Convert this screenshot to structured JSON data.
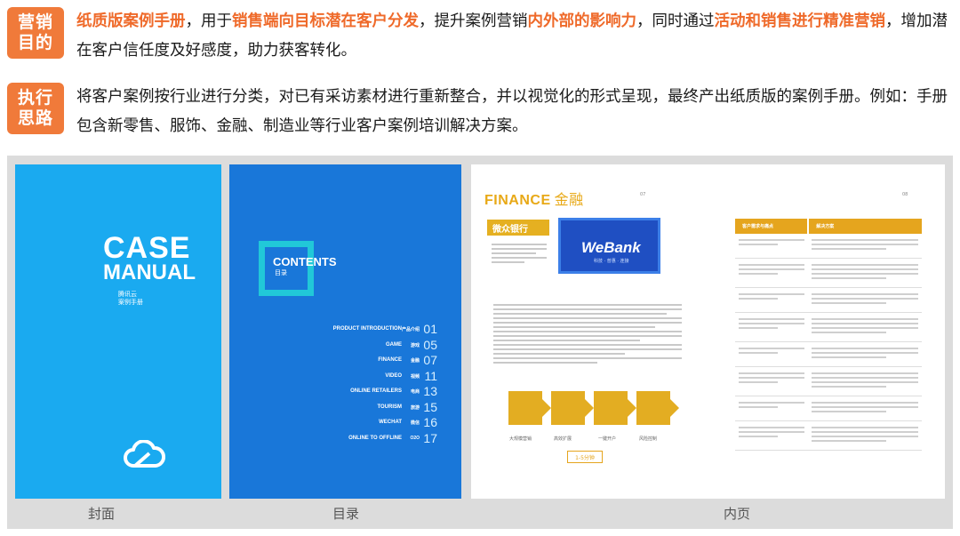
{
  "purpose": {
    "tag": "营销\n目的",
    "segments": [
      {
        "text": "纸质版案例手册",
        "hl": true
      },
      {
        "text": "，用于",
        "hl": false
      },
      {
        "text": "销售端向目标潜在客户分发",
        "hl": true
      },
      {
        "text": "，提升案例营销",
        "hl": false
      },
      {
        "text": "内外部的影响力",
        "hl": true
      },
      {
        "text": "，同时通过",
        "hl": false
      },
      {
        "text": "活动和销售进行精准营销",
        "hl": true
      },
      {
        "text": "，增加潜在客户信任度及好感度，助力获客转化。",
        "hl": false
      }
    ]
  },
  "approach": {
    "tag": "执行\n思路",
    "text": "将客户案例按行业进行分类，对已有采访素材进行重新整合，并以视觉化的形式呈现，最终产出纸质版的案例手册。例如：手册包含新零售、服饰、金融、制造业等行业客户案例培训解决方案。"
  },
  "cover": {
    "title_line1": "CASE",
    "title_line2": "MANUAL",
    "brand": "腾讯云",
    "subtitle": "案例手册",
    "caption": "封面"
  },
  "contents": {
    "title": "CONTENTS",
    "subtitle": "目录",
    "caption": "目录",
    "items": [
      {
        "name": "PRODUCT INTRODUCTION",
        "zh": "产品介绍",
        "num": "01"
      },
      {
        "name": "GAME",
        "zh": "游戏",
        "num": "05"
      },
      {
        "name": "FINANCE",
        "zh": "金融",
        "num": "07"
      },
      {
        "name": "VIDEO",
        "zh": "视频",
        "num": "11"
      },
      {
        "name": "ONLINE RETAILERS",
        "zh": "电商",
        "num": "13"
      },
      {
        "name": "TOURISM",
        "zh": "旅游",
        "num": "15"
      },
      {
        "name": "WECHAT",
        "zh": "微信",
        "num": "16"
      },
      {
        "name": "ONLINE TO OFFLINE",
        "zh": "O2O",
        "num": "17"
      }
    ]
  },
  "inner": {
    "section_en": "FINANCE",
    "section_zh": "金融",
    "page_left": "07",
    "page_right": "08",
    "bank_name": "微众银行",
    "logo": "WeBank",
    "logo_sub": "科技 · 普惠 · 连接",
    "pill": "1-5分钟",
    "caption": "内页",
    "icon_labels": [
      "大规模营销",
      "高效扩展",
      "一键开户",
      "风险控制"
    ],
    "table_head": [
      "客户需求与痛点",
      "解决方案"
    ]
  },
  "colors": {
    "tag_bg": "#f07a3a",
    "highlight": "#ef6a2a",
    "cover_bg": "#1aaaf0",
    "contents_bg": "#1977d9",
    "accent_gold": "#e5a51e"
  }
}
